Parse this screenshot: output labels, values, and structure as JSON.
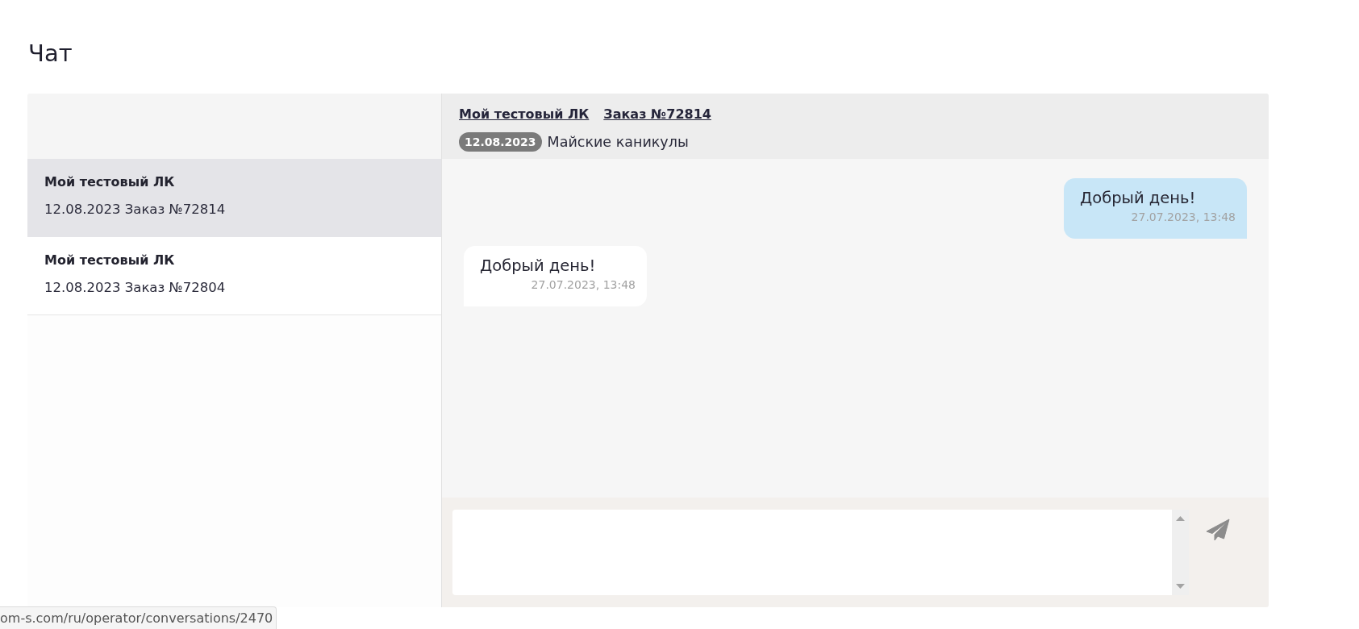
{
  "page": {
    "title": "Чат"
  },
  "conversations": [
    {
      "name": "Мой тестовый ЛК",
      "subtitle": "12.08.2023 Заказ №72814",
      "selected": true
    },
    {
      "name": "Мой тестовый ЛК",
      "subtitle": "12.08.2023 Заказ №72804",
      "selected": false
    }
  ],
  "chat_header": {
    "links": [
      "Мой тестовый ЛК",
      "Заказ №72814"
    ],
    "date_badge": "12.08.2023",
    "subject": "Майские каникулы"
  },
  "messages": [
    {
      "kind": "outgoing",
      "text": "Добрый день!",
      "time": "27.07.2023, 13:48"
    },
    {
      "kind": "incoming",
      "text": "Добрый день!",
      "time": "27.07.2023, 13:48"
    }
  ],
  "status_bar": {
    "url": "om-s.com/ru/operator/conversations/2470"
  }
}
